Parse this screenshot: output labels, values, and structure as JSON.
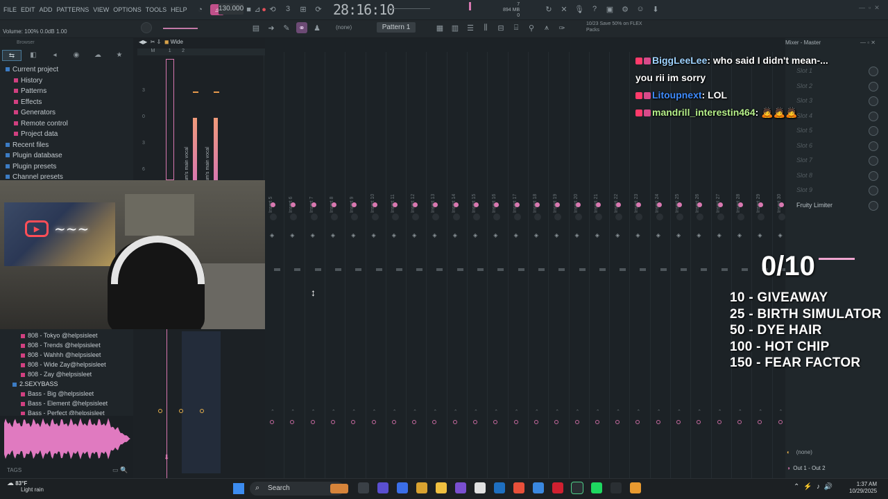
{
  "menu": [
    "FILE",
    "EDIT",
    "ADD",
    "PATTERNS",
    "VIEW",
    "OPTIONS",
    "TOOLS",
    "HELP"
  ],
  "transport": {
    "tempo": "130.000",
    "time": "28:16:10",
    "cpu_value": "7",
    "memory": "894 MB",
    "poly": "0"
  },
  "toolbar2": {
    "volume_readout": "Volume: 100%  0.0dB  1.00",
    "snap": "(none)",
    "pattern": "Pattern 1",
    "promo": "10/23  Save 50% on FLEX Packs"
  },
  "browser": {
    "header": "Browser",
    "tabs": [
      "⇆",
      "◧",
      "◂",
      "◉",
      "☁",
      "★"
    ],
    "tree": [
      {
        "label": "Current project",
        "icon": "blue",
        "indent": 0
      },
      {
        "label": "History",
        "icon": "pink",
        "indent": 1
      },
      {
        "label": "Patterns",
        "icon": "pink",
        "indent": 1
      },
      {
        "label": "Effects",
        "icon": "pink",
        "indent": 1
      },
      {
        "label": "Generators",
        "icon": "pink",
        "indent": 1
      },
      {
        "label": "Remote control",
        "icon": "pink",
        "indent": 1
      },
      {
        "label": "Project data",
        "icon": "pink",
        "indent": 1
      },
      {
        "label": "Recent files",
        "icon": "blue",
        "indent": 0
      },
      {
        "label": "Plugin database",
        "icon": "blue",
        "indent": 0
      },
      {
        "label": "Plugin presets",
        "icon": "blue",
        "indent": 0
      },
      {
        "label": "Channel presets",
        "icon": "blue",
        "indent": 0
      }
    ],
    "lower_tree": [
      {
        "label": "808 - Tokyo @helpsisleet",
        "indent": 1
      },
      {
        "label": "808 - Trends @helpsisleet",
        "indent": 1
      },
      {
        "label": "808 - Wahhh @helpsisleet",
        "indent": 1
      },
      {
        "label": "808 - Wide Zay@helpsisleet",
        "indent": 1
      },
      {
        "label": "808 - Zay @helpsisleet",
        "indent": 1
      },
      {
        "label": "2.SEXYBASS",
        "indent": 0
      },
      {
        "label": "Bass - Big @helpsisleet",
        "indent": 1
      },
      {
        "label": "Bass - Element @helpsisleet",
        "indent": 1
      },
      {
        "label": "Bass - Perfect @helpsisleet",
        "indent": 1
      }
    ],
    "tags": "TAGS"
  },
  "channel": {
    "header": "Wide",
    "track_labels": [
      "um's main vocal",
      "um's main vocal"
    ]
  },
  "mixer": {
    "inserts": [
      "Insert 5",
      "Insert 6",
      "Insert 7",
      "Insert 8",
      "Insert 9",
      "Insert 10",
      "Insert 11",
      "Insert 12",
      "Insert 13",
      "Insert 14",
      "Insert 15",
      "Insert 16",
      "Insert 17",
      "Insert 18",
      "Insert 19",
      "Insert 20",
      "Insert 21",
      "Insert 22",
      "Insert 23",
      "Insert 24",
      "Insert 25",
      "Insert 26",
      "Insert 27",
      "Insert 28",
      "Insert 29",
      "Insert 30"
    ]
  },
  "mixer_master": {
    "title": "Mixer - Master",
    "slots": [
      "Slot 1",
      "Slot 2",
      "Slot 3",
      "Slot 4",
      "Slot 5",
      "Slot 6",
      "Slot 7",
      "Slot 8",
      "Slot 9",
      "Fruity Limiter"
    ],
    "input": "(none)",
    "output": "Out 1 - Out 2"
  },
  "chat": [
    {
      "user": "BiggLeeLee",
      "user_color": "#9fd3ff",
      "message": "who said I didn't mean-..."
    },
    {
      "user": "",
      "user_color": "#ffffff",
      "message": "you rii im sorry"
    },
    {
      "user": "Litoupnext",
      "user_color": "#3f8cff",
      "message": "LOL"
    },
    {
      "user": "mandrill_interestin464",
      "user_color": "#b6f08a",
      "message": "🙇🙇🙇"
    }
  ],
  "goals": {
    "count": "0/10",
    "items": [
      "10 - GIVEAWAY",
      "25 - BIRTH SIMULATOR",
      "50 - DYE HAIR",
      "100 - HOT CHIP",
      "150 - FEAR FACTOR"
    ]
  },
  "taskbar": {
    "temperature": "83°F",
    "weather": "Light rain",
    "search": "Search",
    "time": "1:37 AM",
    "date": "10/29/2025"
  },
  "colors": {
    "accent": "#d878b0",
    "mixer_bg": "#1c2226"
  }
}
